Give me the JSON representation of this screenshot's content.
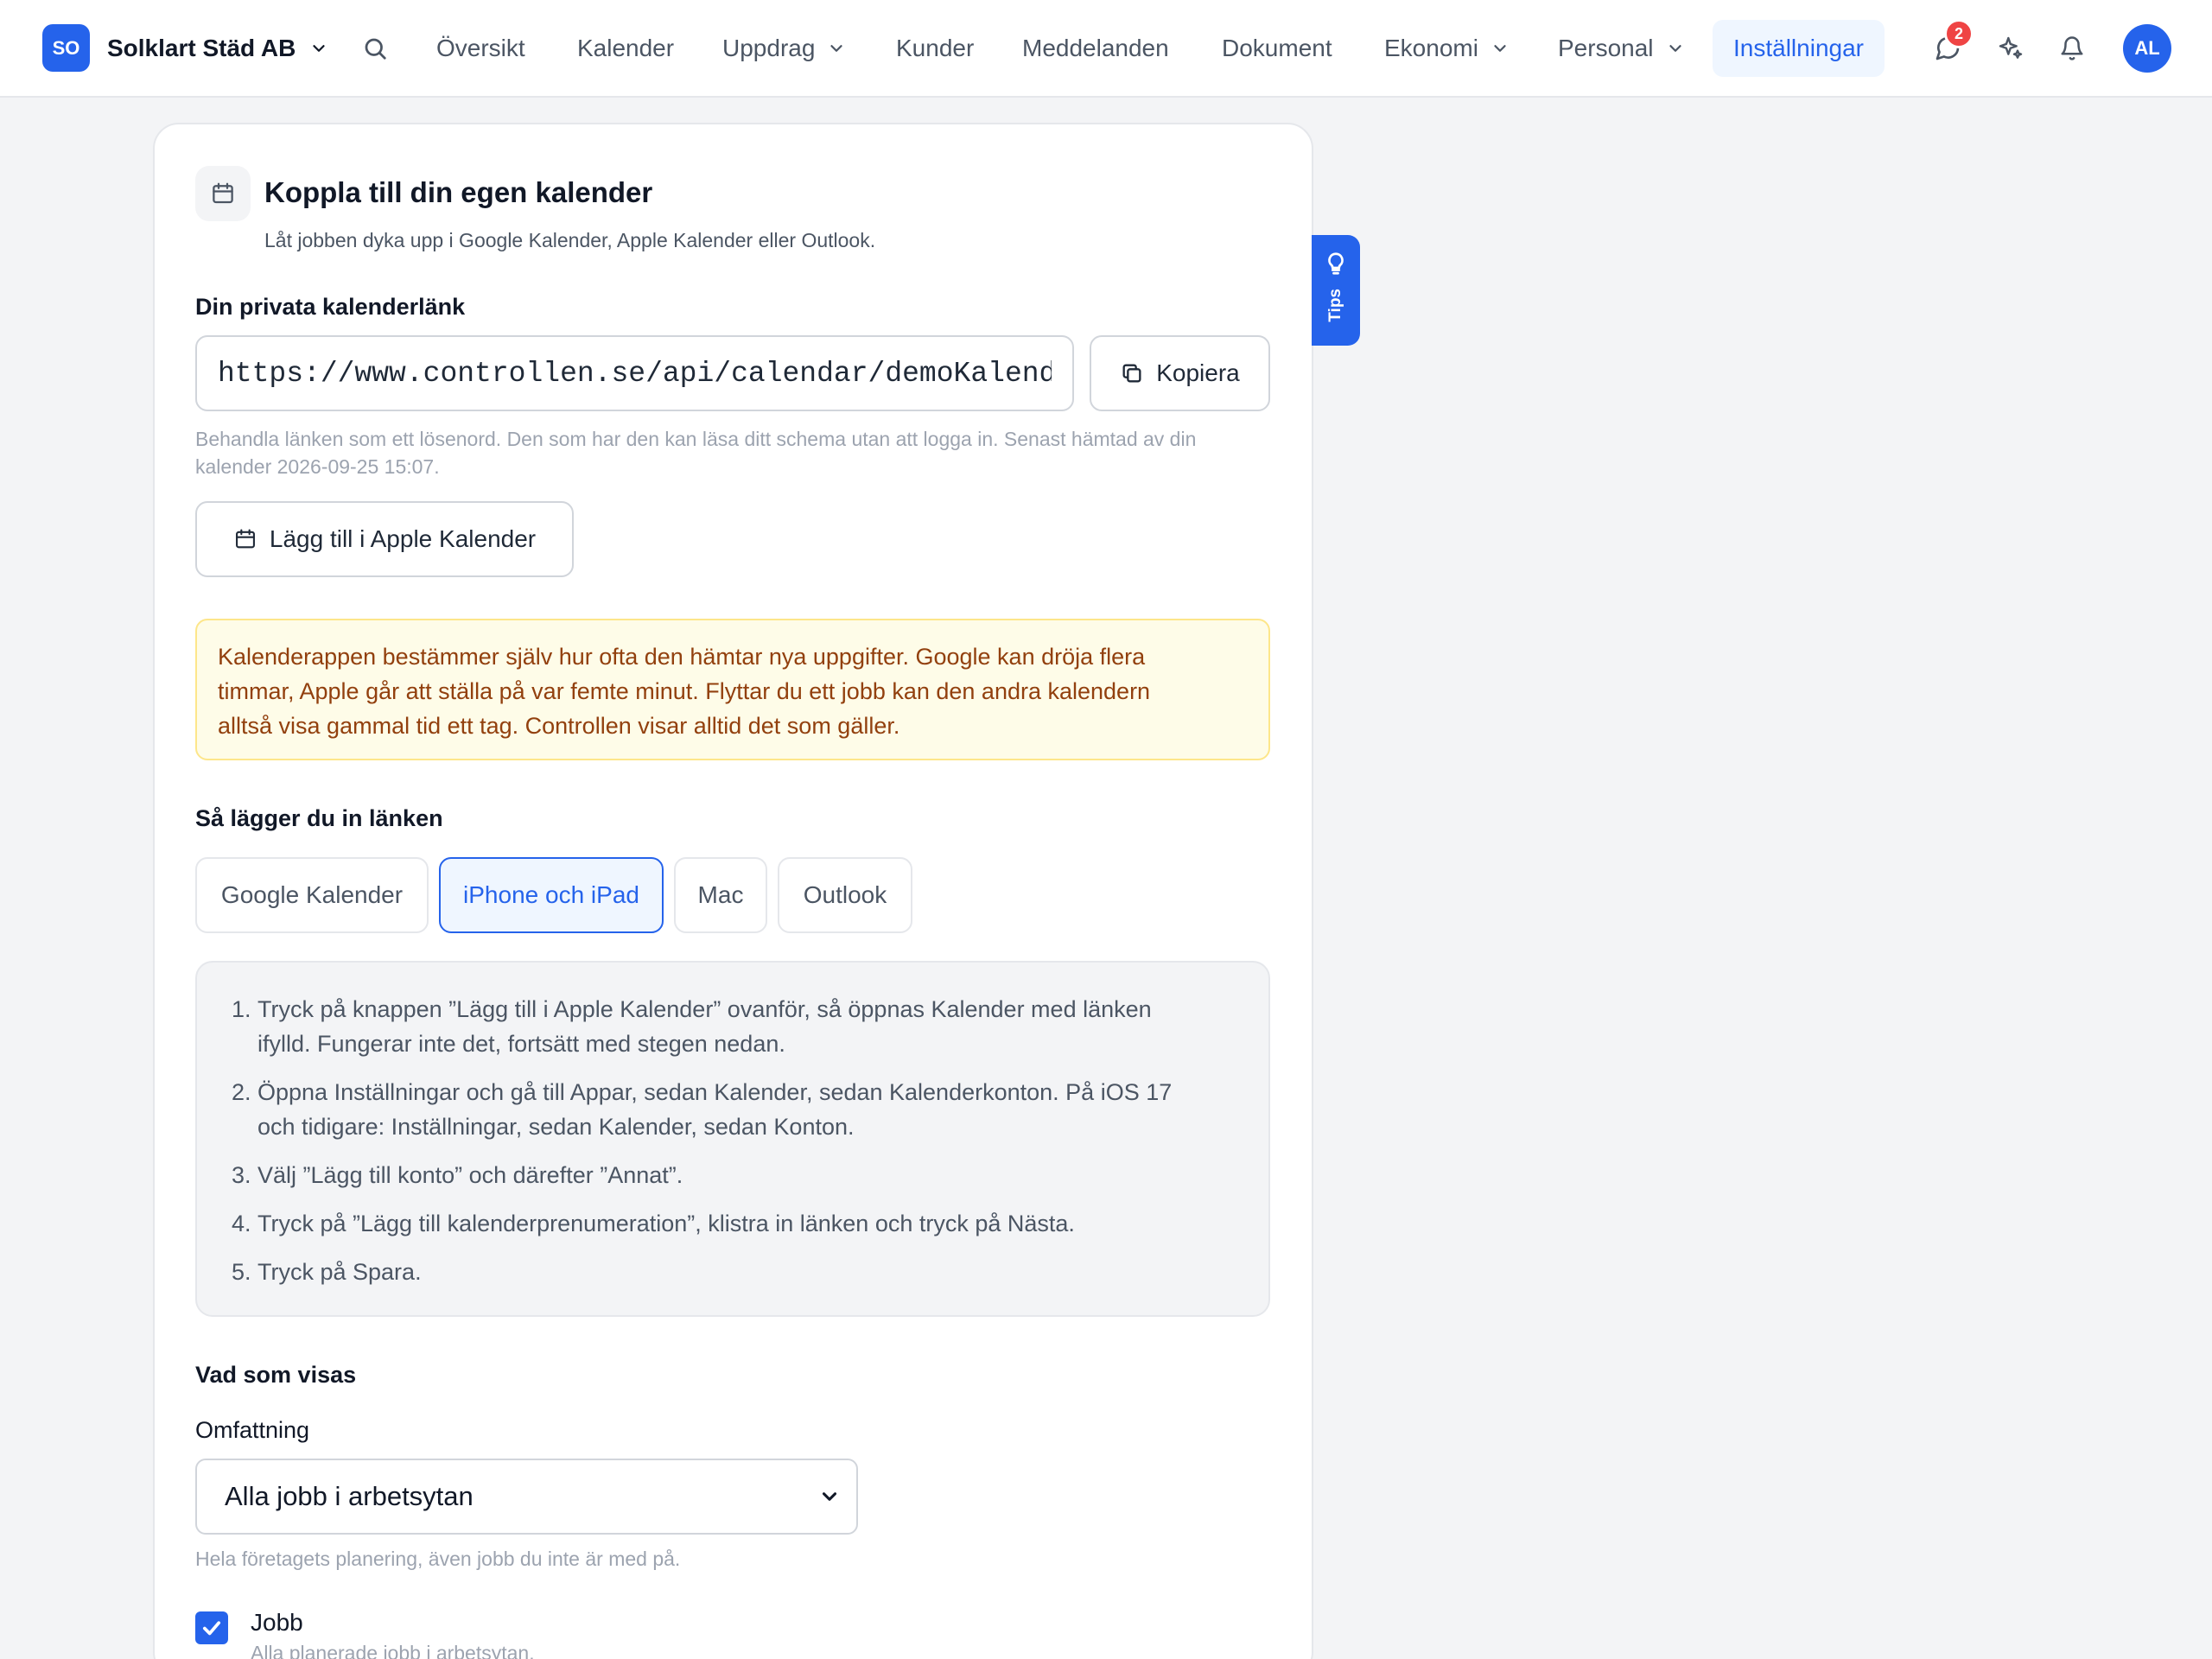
{
  "header": {
    "logo_initials": "SO",
    "company_name": "Solklart Städ AB",
    "nav": {
      "overview": "Översikt",
      "calendar": "Kalender",
      "assignments": "Uppdrag",
      "customers": "Kunder",
      "messages": "Meddelanden",
      "documents": "Dokument",
      "economy": "Ekonomi",
      "staff": "Personal",
      "settings": "Inställningar"
    },
    "messages_badge": "2",
    "avatar_initials": "AL"
  },
  "card": {
    "title": "Koppla till din egen kalender",
    "subtitle": "Låt jobben dyka upp i Google Kalender, Apple Kalender eller Outlook.",
    "link_label": "Din privata kalenderlänk",
    "link_value": "https://www.controllen.se/api/calendar/demoKalender",
    "copy_button": "Kopiera",
    "link_help_line1": "Behandla länken som ett lösenord. Den som har den kan läsa ditt schema utan att logga in. Senast hämtad av din",
    "link_help_line2": "kalender 2026-09-25 15:07.",
    "apple_button": "Lägg till i Apple Kalender",
    "warning_line1": "Kalenderappen bestämmer själv hur ofta den hämtar nya uppgifter. Google kan dröja flera",
    "warning_line2": "timmar, Apple går att ställa på var femte minut. Flyttar du ett jobb kan den andra kalendern",
    "warning_line3": "alltså visa gammal tid ett tag. Controllen visar alltid det som gäller.",
    "howto_title": "Så lägger du in länken",
    "tabs": {
      "google": "Google Kalender",
      "iphone": "iPhone och iPad",
      "mac": "Mac",
      "outlook": "Outlook"
    },
    "steps": [
      {
        "num": "1.",
        "line1": "Tryck på knappen ”Lägg till i Apple Kalender” ovanför, så öppnas Kalender med länken",
        "line2": "ifylld. Fungerar inte det, fortsätt med stegen nedan."
      },
      {
        "num": "2.",
        "line1": "Öppna Inställningar och gå till Appar, sedan Kalender, sedan Kalenderkonton. På iOS 17",
        "line2": "och tidigare: Inställningar, sedan Kalender, sedan Konton."
      },
      {
        "num": "3.",
        "line1": "Välj ”Lägg till konto” och därefter ”Annat”."
      },
      {
        "num": "4.",
        "line1": "Tryck på ”Lägg till kalenderprenumeration”, klistra in länken och tryck på Nästa."
      },
      {
        "num": "5.",
        "line1": "Tryck på Spara."
      }
    ],
    "shown_title": "Vad som visas",
    "scope_label": "Omfattning",
    "scope_value": "Alla jobb i arbetsytan",
    "scope_help": "Hela företagets planering, även jobb du inte är med på.",
    "jobs_label": "Jobb",
    "jobs_help": "Alla planerade jobb i arbetsytan."
  },
  "tips_label": "Tips",
  "colors": {
    "accent": "#2563eb",
    "warning_bg": "#fefce8",
    "warning_text": "#92400e",
    "badge": "#ef4444"
  }
}
